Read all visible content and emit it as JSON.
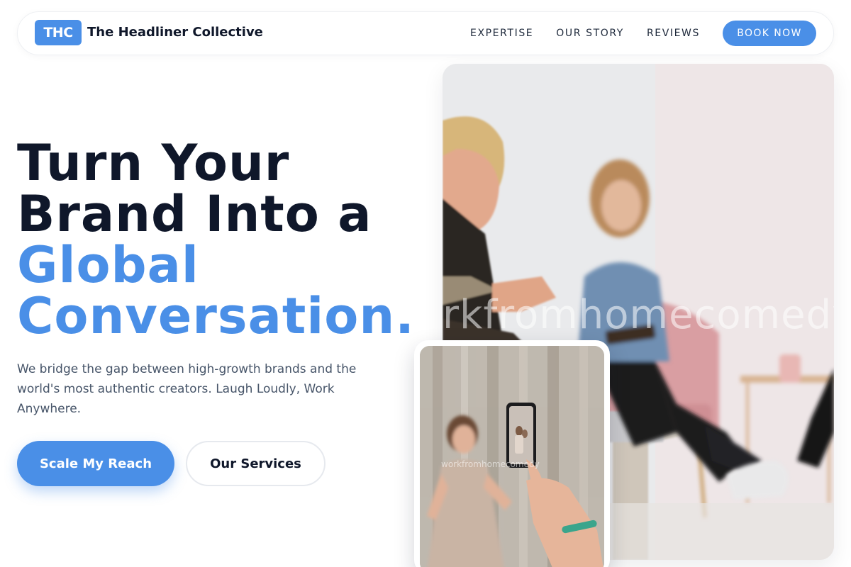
{
  "nav": {
    "logo_badge": "THC",
    "brand_name": "The Headliner Collective",
    "links": [
      "EXPERTISE",
      "OUR STORY",
      "REVIEWS"
    ],
    "cta": "BOOK NOW"
  },
  "hero": {
    "headline_line1": "Turn Your",
    "headline_line2": "Brand Into a",
    "headline_line3": "Global",
    "headline_line4": "Conversation.",
    "subtext": "We bridge the gap between high-growth brands and the world's most authentic creators. Laugh Loudly, Work Anywhere.",
    "primary_button": "Scale My Reach",
    "secondary_button": "Our Services"
  },
  "images": {
    "main_watermark": "rkfromhomecomedy.c",
    "small_watermark": "workfromhomecomedy"
  },
  "colors": {
    "accent": "#4a8fe7",
    "heading": "#0f172a",
    "body_text": "#475569"
  }
}
